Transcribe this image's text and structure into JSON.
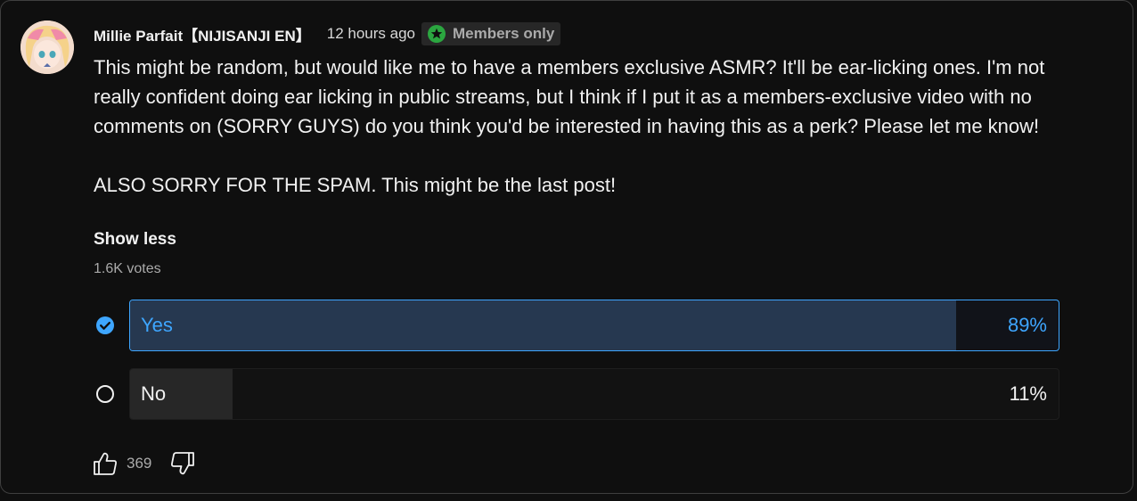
{
  "post": {
    "author": "Millie Parfait【NIJISANJI EN】",
    "time": "12 hours ago",
    "badge_label": "Members only",
    "badge_icon": "star-icon",
    "badge_icon_color": "#2ba640",
    "paragraphs": [
      "This might be random, but would like me to have a members exclusive ASMR? It'll be ear-licking ones. I'm not really confident doing ear licking in public streams, but I think if I put it as a members-exclusive video with no comments on (SORRY GUYS) do you think you'd be interested in having this as a perk? Please let me know!",
      "ALSO SORRY FOR THE SPAM. This might be the last post!"
    ],
    "show_less_label": "Show less"
  },
  "poll": {
    "votes_label": "1.6K votes",
    "accent_color": "#3ea6ff",
    "options": [
      {
        "label": "Yes",
        "percent_label": "89%",
        "share": 0.89,
        "selected": true
      },
      {
        "label": "No",
        "percent_label": "11%",
        "share": 0.11,
        "selected": false
      }
    ]
  },
  "actions": {
    "like_icon": "thumbs-up-icon",
    "like_count": "369",
    "dislike_icon": "thumbs-down-icon"
  }
}
